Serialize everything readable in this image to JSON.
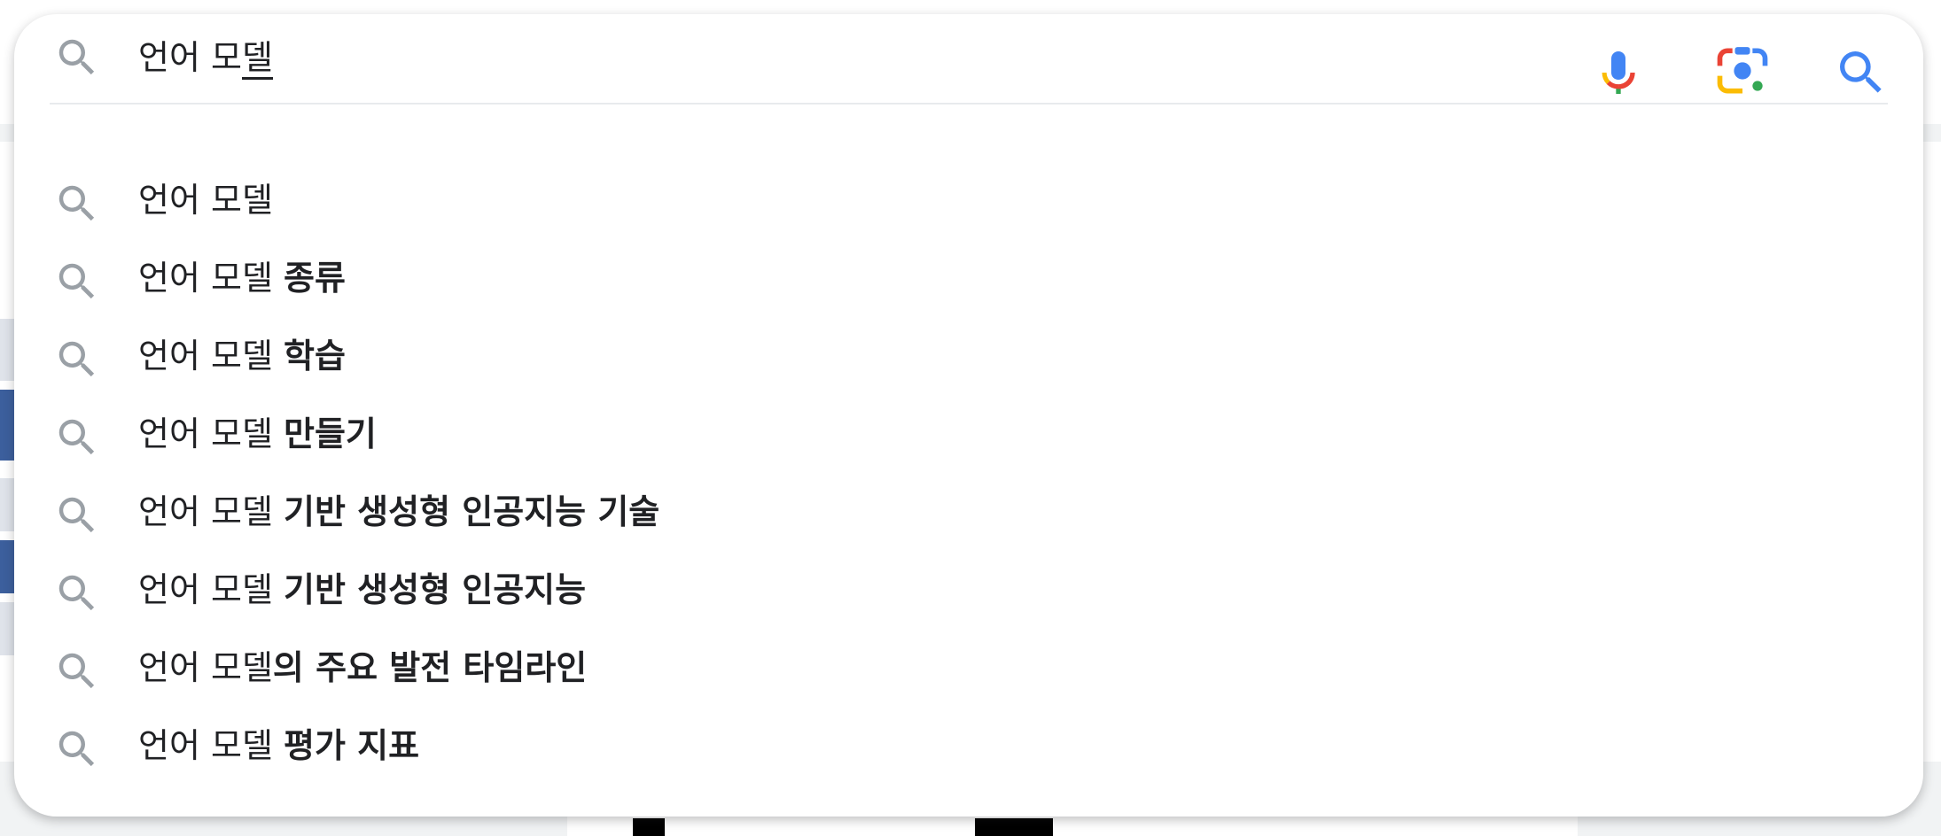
{
  "search": {
    "query_prefix": "언어 모",
    "query_last": "델",
    "voice_button_label": "voice-search",
    "lens_button_label": "search-by-image",
    "submit_button_label": "search"
  },
  "suggestions": [
    {
      "typed": "언어 모델",
      "completion": ""
    },
    {
      "typed": "언어 모델 ",
      "completion": "종류"
    },
    {
      "typed": "언어 모델 ",
      "completion": "학습"
    },
    {
      "typed": "언어 모델 ",
      "completion": "만들기"
    },
    {
      "typed": "언어 모델 ",
      "completion": "기반 생성형 인공지능 기술"
    },
    {
      "typed": "언어 모델 ",
      "completion": "기반 생성형 인공지능"
    },
    {
      "typed": "언어 모델",
      "completion": "의 주요 발전 타임라인"
    },
    {
      "typed": "언어 모델 ",
      "completion": "평가 지표"
    }
  ],
  "colors": {
    "icon_gray": "#9aa0a6",
    "google_blue": "#4285f4",
    "google_red": "#ea4335",
    "google_yellow": "#fbbc04",
    "google_green": "#34a853",
    "text": "#202124"
  },
  "icons": {
    "search": "magnifier",
    "mic": "microphone",
    "lens": "camera-lens"
  }
}
